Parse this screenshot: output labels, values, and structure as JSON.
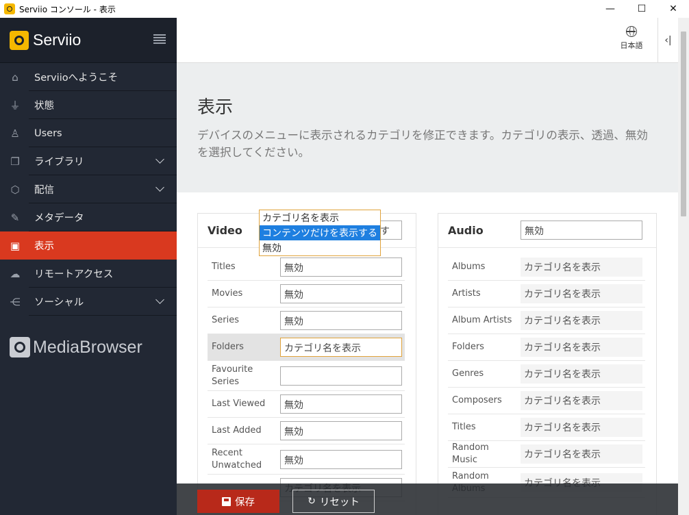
{
  "window": {
    "title": "Serviio コンソール - 表示",
    "minimize": "—",
    "maximize": "☐",
    "close": "✕"
  },
  "sidebar": {
    "brand": "Serviio",
    "items": [
      {
        "label": "Serviioへようこそ",
        "icon": "home-icon",
        "glyph": "⌂"
      },
      {
        "label": "状態",
        "icon": "plug-icon",
        "glyph": "⏚"
      },
      {
        "label": "Users",
        "icon": "user-icon",
        "glyph": "♙"
      },
      {
        "label": "ライブラリ",
        "icon": "files-icon",
        "glyph": "❐"
      },
      {
        "label": "配信",
        "icon": "cube-icon",
        "glyph": "⬡"
      },
      {
        "label": "メタデータ",
        "icon": "edit-icon",
        "glyph": "✎"
      },
      {
        "label": "表示",
        "icon": "display-icon",
        "glyph": "▣"
      },
      {
        "label": "リモートアクセス",
        "icon": "cloud-icon",
        "glyph": "☁"
      },
      {
        "label": "ソーシャル",
        "icon": "share-icon",
        "glyph": "⋲"
      }
    ],
    "footer_logo": "MediaBrowser"
  },
  "topbar": {
    "language": "日本語",
    "collapse": "‹|"
  },
  "hero": {
    "title": "表示",
    "description": "デバイスのメニューに表示されるカテゴリを修正できます。カテゴリの表示、透過、無効を選択してください。"
  },
  "video": {
    "title": "Video",
    "value": "コンテンツだけを表示する",
    "rows": [
      {
        "label": "Titles",
        "value": "無効"
      },
      {
        "label": "Movies",
        "value": "無効"
      },
      {
        "label": "Series",
        "value": "無効"
      },
      {
        "label": "Folders",
        "value": "カテゴリ名を表示"
      },
      {
        "label": "Favourite Series",
        "value": ""
      },
      {
        "label": "Last Viewed",
        "value": "無効"
      },
      {
        "label": "Last Added",
        "value": "無効"
      },
      {
        "label": "Recent Unwatched",
        "value": "無効"
      },
      {
        "label": "",
        "value": "カテゴリ名を表示"
      }
    ],
    "dropdown_options": [
      "カテゴリ名を表示",
      "コンテンツだけを表示する",
      "無効"
    ]
  },
  "audio": {
    "title": "Audio",
    "value": "無効",
    "rows": [
      {
        "label": "Albums",
        "value": "カテゴリ名を表示"
      },
      {
        "label": "Artists",
        "value": "カテゴリ名を表示"
      },
      {
        "label": "Album Artists",
        "value": "カテゴリ名を表示"
      },
      {
        "label": "Folders",
        "value": "カテゴリ名を表示"
      },
      {
        "label": "Genres",
        "value": "カテゴリ名を表示"
      },
      {
        "label": "Composers",
        "value": "カテゴリ名を表示"
      },
      {
        "label": "Titles",
        "value": "カテゴリ名を表示"
      },
      {
        "label": "Random Music",
        "value": "カテゴリ名を表示"
      },
      {
        "label": "Random Albums",
        "value": "カテゴリ名を表示"
      }
    ]
  },
  "actions": {
    "save": "保存",
    "reset": "リセット",
    "reset_glyph": "↻"
  },
  "colors": {
    "accent": "#d9391f",
    "sidebar": "#222834",
    "brand_yellow": "#f5b800",
    "selection": "#1e7fe0"
  }
}
